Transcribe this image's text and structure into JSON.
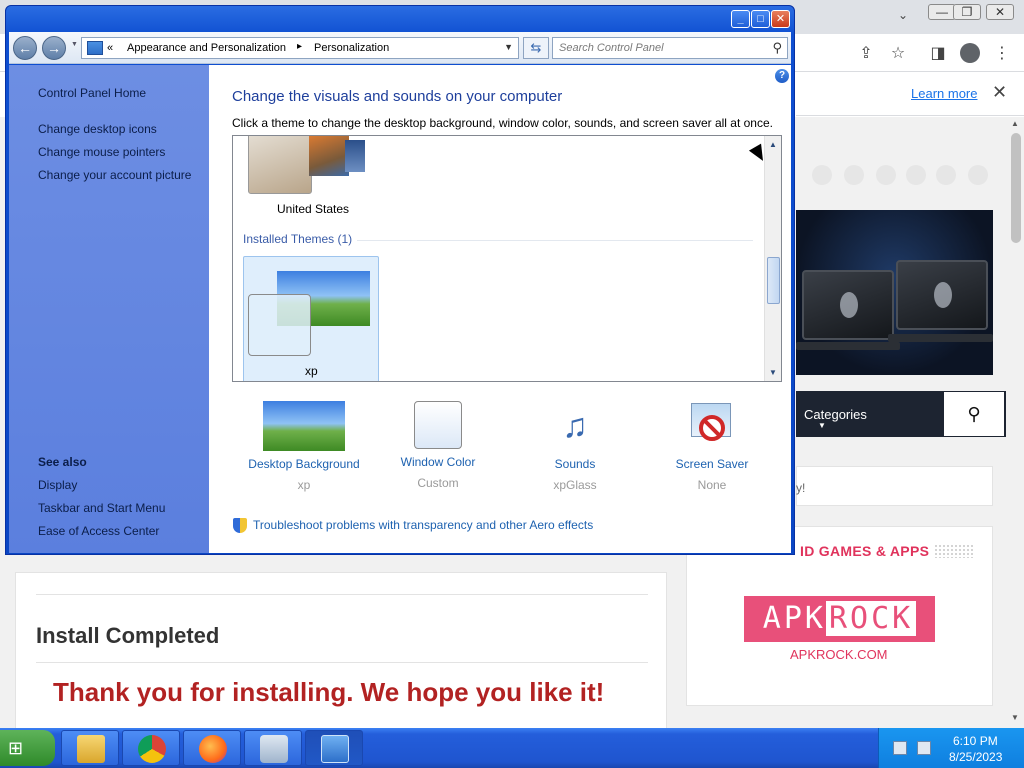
{
  "browser": {
    "learn_more": "Learn more",
    "close_glyph": "✕",
    "titlebar_chevron": "⌄",
    "win_min": "—",
    "win_max": "❐",
    "win_close": "✕",
    "categories_label": "Categories",
    "side_teaser": "y!",
    "games_title": "ID GAMES & APPS",
    "apk_logo_a": "APK",
    "apk_logo_b": "ROCK",
    "apk_url": "APKROCK.COM",
    "install_title": "Install Completed",
    "thanks_text": "Thank you for installing. We hope you like it!"
  },
  "window": {
    "min_label": "_",
    "max_label": "□",
    "close_label": "✕",
    "breadcrumb_prefix": "«",
    "breadcrumb": [
      "Appearance and Personalization",
      "Personalization"
    ],
    "search_placeholder": "Search Control Panel"
  },
  "left_nav": {
    "home": "Control Panel Home",
    "links": [
      "Change desktop icons",
      "Change mouse pointers",
      "Change your account picture"
    ],
    "see_also_title": "See also",
    "see_also": [
      "Display",
      "Taskbar and Start Menu",
      "Ease of Access Center"
    ]
  },
  "main": {
    "heading": "Change the visuals and sounds on your computer",
    "subheading": "Click a theme to change the desktop background, window color, sounds, and screen saver all at once.",
    "theme_partial_label": "United States",
    "installed_section": "Installed Themes (1)",
    "installed_theme": "xp",
    "settings": [
      {
        "name": "Desktop Background",
        "value": "xp"
      },
      {
        "name": "Window Color",
        "value": "Custom"
      },
      {
        "name": "Sounds",
        "value": "xpGlass"
      },
      {
        "name": "Screen Saver",
        "value": "None"
      }
    ],
    "aero_link": "Troubleshoot problems with transparency and other Aero effects"
  },
  "taskbar": {
    "start_glyph": "⊞",
    "items": [
      "explorer",
      "chrome",
      "firefox",
      "media-center",
      "control-panel"
    ],
    "time": "6:10 PM",
    "date": "8/25/2023"
  },
  "colors": {
    "window_frame": "#0a46c4",
    "left_nav": "#5b7fde",
    "heading_blue": "#1e3f9c",
    "link_blue": "#1e62b0",
    "brand_pink": "#e8507a",
    "thanks_red": "#b22222"
  }
}
